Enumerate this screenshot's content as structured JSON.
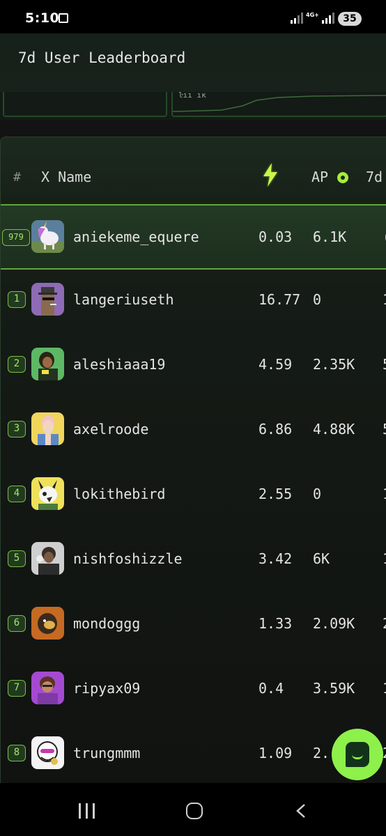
{
  "status_bar": {
    "time": "5:10",
    "network": "4G+",
    "battery": "35"
  },
  "header": {
    "title": "7d User Leaderboard"
  },
  "chart_strip": {
    "cut_text": "ŀıı ıĸ"
  },
  "table": {
    "columns": {
      "rank": "#",
      "name": "X Name",
      "score_icon": "lightning-bolt-icon",
      "ap": "AP",
      "ap_icon": "ap-coin-icon",
      "seven_day": "7d"
    },
    "current_user": {
      "rank": "979",
      "name": "aniekeme_equere",
      "score": "0.03",
      "ap": "6.1K",
      "d7": "("
    },
    "rows": [
      {
        "rank": "1",
        "name": "langeriuseth",
        "score": "16.77",
        "ap": "0",
        "d7": "1"
      },
      {
        "rank": "2",
        "name": "aleshiaaa19",
        "score": "4.59",
        "ap": "2.35K",
        "d7": "5"
      },
      {
        "rank": "3",
        "name": "axelroode",
        "score": "6.86",
        "ap": "4.88K",
        "d7": "5"
      },
      {
        "rank": "4",
        "name": "lokithebird",
        "score": "2.55",
        "ap": "0",
        "d7": "1"
      },
      {
        "rank": "5",
        "name": "nishfoshizzle",
        "score": "3.42",
        "ap": "6K",
        "d7": "1"
      },
      {
        "rank": "6",
        "name": "mondoggg",
        "score": "1.33",
        "ap": "2.09K",
        "d7": "2"
      },
      {
        "rank": "7",
        "name": "ripyax09",
        "score": "0.4",
        "ap": "3.59K",
        "d7": "1"
      },
      {
        "rank": "8",
        "name": "trungmmm",
        "score": "1.09",
        "ap": "2.",
        "d7": "2"
      }
    ]
  },
  "colors": {
    "accent": "#8ef04a",
    "rank_border": "#79c043",
    "background": "#131313"
  }
}
